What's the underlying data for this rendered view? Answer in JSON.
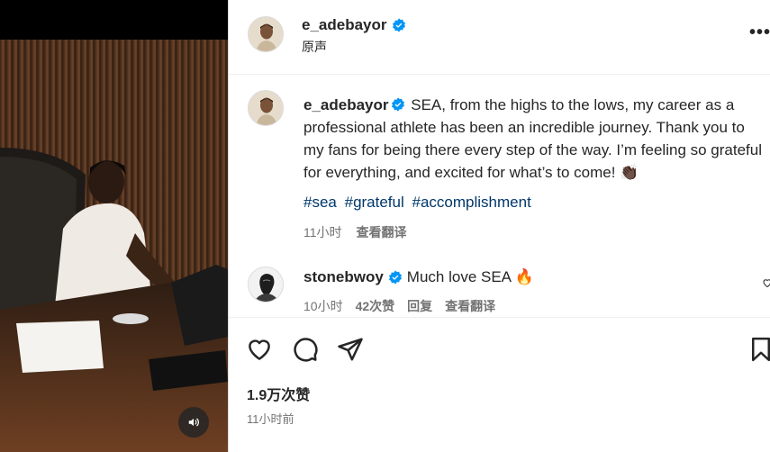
{
  "post_header": {
    "username": "e_adebayor",
    "audio_label": "原声",
    "more_label": "•••"
  },
  "caption": {
    "username": "e_adebayor",
    "text": "SEA, from the highs to the lows, my career as a professional athlete has been an incredible journey. Thank you to my fans for being there every step of the way. I’m feeling so grateful for everything, and excited for what’s to come! 👏🏿",
    "hashtags": [
      "#sea",
      "#grateful",
      "#accomplishment"
    ],
    "time": "11小时",
    "translate_label": "查看翻译"
  },
  "comment": {
    "username": "stonebwoy",
    "text": "Much love SEA 🔥",
    "time": "10小时",
    "likes": "42次赞",
    "reply_label": "回复",
    "translate_label": "查看翻译"
  },
  "engagement": {
    "likes": "1.9万次赞",
    "time_ago": "11小时前"
  },
  "icons": {
    "verified": "verified-badge-icon",
    "like": "heart-icon",
    "comment": "comment-icon",
    "share": "share-icon",
    "save": "bookmark-icon",
    "mute": "speaker-icon"
  },
  "colors": {
    "verified": "#0095f6",
    "hashtag": "#00376b",
    "secondary_text": "#737373"
  }
}
